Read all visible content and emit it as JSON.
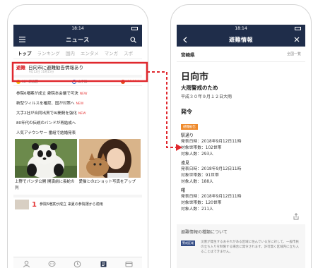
{
  "status_time": "18:14",
  "left": {
    "header_title": "ニュース",
    "tabs": [
      {
        "label": "トップ",
        "active": true
      },
      {
        "label": "ランキング"
      },
      {
        "label": "国内"
      },
      {
        "label": "エンタメ"
      },
      {
        "label": "マンガ"
      },
      {
        "label": "スポ"
      }
    ],
    "alert": {
      "tag": "避難",
      "text": "日向市に避難勧告情報あり",
      "sub": "9月12日 11時15分"
    },
    "weather": {
      "temp": "32° 新宿区",
      "train": "山手線",
      "rating": "★★★★☆"
    },
    "headlines": [
      {
        "text": "参院6増案が成立 衆院本会議で可決",
        "new": "NEW"
      },
      {
        "text": "新型ウィルスを確認、国が対策へ",
        "new": "NEW"
      },
      {
        "text": "大手2社が合同出資でAI開発を強化",
        "new": "NEW"
      },
      {
        "text": "80年代の伝説のバンドが再結成へ",
        "new": ""
      },
      {
        "text": "人気アナウンサー 番組で結婚発表",
        "new": ""
      }
    ],
    "photo_captions": [
      "上野でパンダ公開 開演前に長蛇の列",
      "愛猫との2ショット写真をアップ"
    ],
    "more": {
      "rank": "1",
      "text": "参院6増案が成立 来夏の参院選から適用"
    }
  },
  "right": {
    "header_title": "避難情報",
    "location": "宮崎県",
    "all_link": "全国一覧",
    "city": "日向市",
    "reason": "大雨警戒のため",
    "date": "平成３０年９月１２日大雨",
    "section_title": "発令",
    "section_badge": "避難勧告",
    "areas": [
      {
        "name": "駅通り",
        "issued": "発表日時：2018年9月12日11時",
        "households": "対象世帯数：102世帯",
        "people": "対象人数：293人"
      },
      {
        "name": "遠見",
        "issued": "発表日時：2018年9月12日11時",
        "households": "対象世帯数：91世帯",
        "people": "対象人数：188人"
      },
      {
        "name": "曙",
        "issued": "発表日時：2018年9月12日11時",
        "households": "対象世帯数：120世帯",
        "people": "対象人数：211人"
      }
    ],
    "info_title": "避難情報の種類について",
    "info_tag": "警戒区域",
    "info_text": "災害が発生するおそれがある区域に住んでいる方に対して、一般市民の立ち入りを制限する場合に発令されます。許可無く区域内に立ち入ることはできません。"
  },
  "colors": {
    "header": "#1f2d4a",
    "alert_red": "#e0282e",
    "badge_orange": "#ef8a2b"
  }
}
